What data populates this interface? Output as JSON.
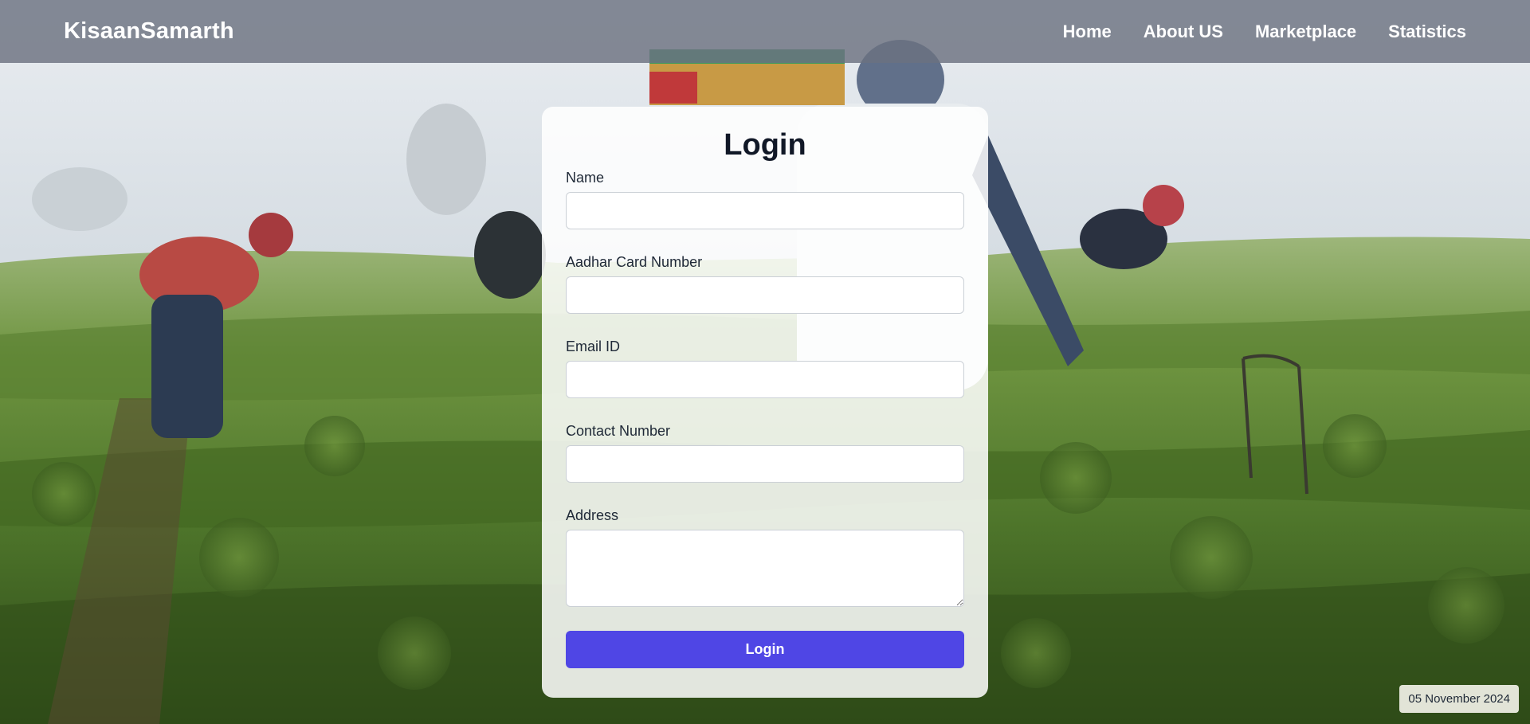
{
  "brand": "KisaanSamarth",
  "nav": {
    "items": [
      "Home",
      "About US",
      "Marketplace",
      "Statistics"
    ]
  },
  "form": {
    "title": "Login",
    "fields": {
      "name_label": "Name",
      "aadhar_label": "Aadhar Card Number",
      "email_label": "Email ID",
      "contact_label": "Contact Number",
      "address_label": "Address"
    },
    "submit_label": "Login"
  },
  "date": "05 November 2024",
  "colors": {
    "navbar": "#6b7280",
    "accent": "#4f46e5",
    "title": "#111827"
  }
}
